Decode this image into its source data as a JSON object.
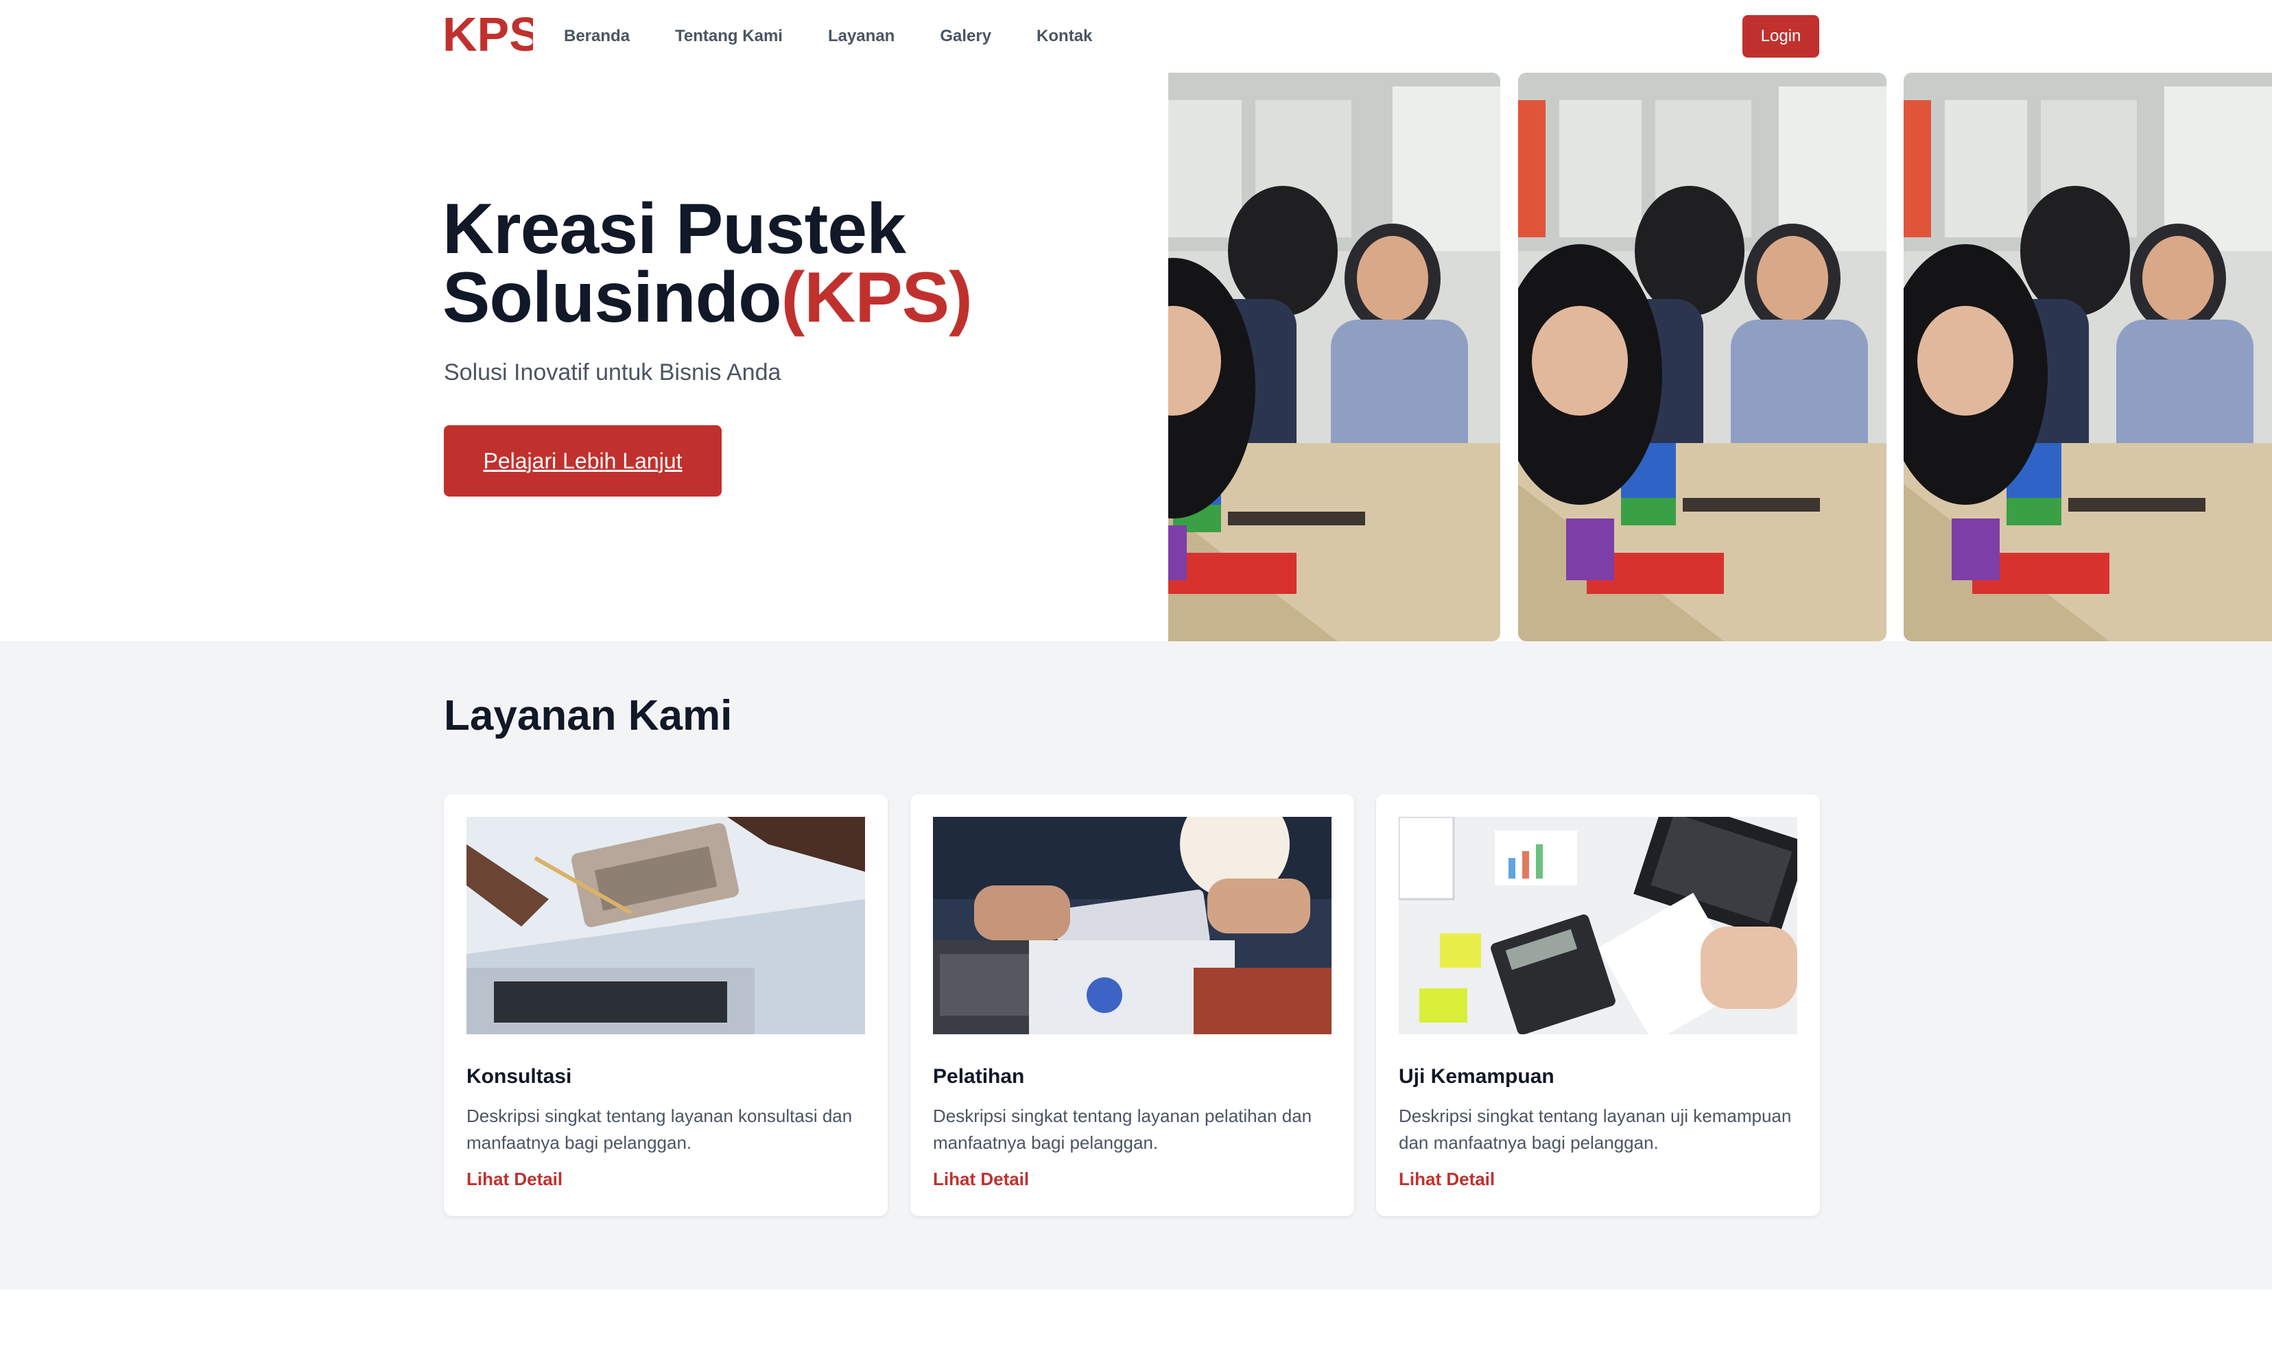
{
  "brand": {
    "logo_text": "KPS",
    "accent_color": "#c0312e"
  },
  "nav": {
    "items": [
      {
        "label": "Beranda"
      },
      {
        "label": "Tentang Kami"
      },
      {
        "label": "Layanan"
      },
      {
        "label": "Galery"
      },
      {
        "label": "Kontak"
      }
    ],
    "login_label": "Login"
  },
  "hero": {
    "title_line1": "Kreasi Pustek",
    "title_line2": "Solusindo",
    "title_accent": "(KPS)",
    "subtitle": "Solusi Inovatif untuk Bisnis Anda",
    "cta_label": "Pelajari Lebih Lanjut"
  },
  "services": {
    "title": "Layanan Kami",
    "cards": [
      {
        "title": "Konsultasi",
        "description": "Deskripsi singkat tentang layanan konsultasi dan manfaatnya bagi pelanggan.",
        "link_label": "Lihat Detail"
      },
      {
        "title": "Pelatihan",
        "description": "Deskripsi singkat tentang layanan pelatihan dan manfaatnya bagi pelanggan.",
        "link_label": "Lihat Detail"
      },
      {
        "title": "Uji Kemampuan",
        "description": "Deskripsi singkat tentang layanan uji kemampuan dan manfaatnya bagi pelanggan.",
        "link_label": "Lihat Detail"
      }
    ]
  }
}
